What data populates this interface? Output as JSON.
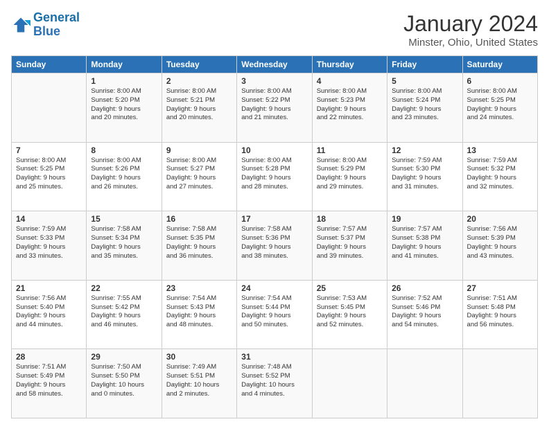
{
  "logo": {
    "line1": "General",
    "line2": "Blue"
  },
  "title": "January 2024",
  "subtitle": "Minster, Ohio, United States",
  "days_of_week": [
    "Sunday",
    "Monday",
    "Tuesday",
    "Wednesday",
    "Thursday",
    "Friday",
    "Saturday"
  ],
  "weeks": [
    [
      {
        "day": "",
        "content": ""
      },
      {
        "day": "1",
        "content": "Sunrise: 8:00 AM\nSunset: 5:20 PM\nDaylight: 9 hours\nand 20 minutes."
      },
      {
        "day": "2",
        "content": "Sunrise: 8:00 AM\nSunset: 5:21 PM\nDaylight: 9 hours\nand 20 minutes."
      },
      {
        "day": "3",
        "content": "Sunrise: 8:00 AM\nSunset: 5:22 PM\nDaylight: 9 hours\nand 21 minutes."
      },
      {
        "day": "4",
        "content": "Sunrise: 8:00 AM\nSunset: 5:23 PM\nDaylight: 9 hours\nand 22 minutes."
      },
      {
        "day": "5",
        "content": "Sunrise: 8:00 AM\nSunset: 5:24 PM\nDaylight: 9 hours\nand 23 minutes."
      },
      {
        "day": "6",
        "content": "Sunrise: 8:00 AM\nSunset: 5:25 PM\nDaylight: 9 hours\nand 24 minutes."
      }
    ],
    [
      {
        "day": "7",
        "content": "Sunrise: 8:00 AM\nSunset: 5:25 PM\nDaylight: 9 hours\nand 25 minutes."
      },
      {
        "day": "8",
        "content": "Sunrise: 8:00 AM\nSunset: 5:26 PM\nDaylight: 9 hours\nand 26 minutes."
      },
      {
        "day": "9",
        "content": "Sunrise: 8:00 AM\nSunset: 5:27 PM\nDaylight: 9 hours\nand 27 minutes."
      },
      {
        "day": "10",
        "content": "Sunrise: 8:00 AM\nSunset: 5:28 PM\nDaylight: 9 hours\nand 28 minutes."
      },
      {
        "day": "11",
        "content": "Sunrise: 8:00 AM\nSunset: 5:29 PM\nDaylight: 9 hours\nand 29 minutes."
      },
      {
        "day": "12",
        "content": "Sunrise: 7:59 AM\nSunset: 5:30 PM\nDaylight: 9 hours\nand 31 minutes."
      },
      {
        "day": "13",
        "content": "Sunrise: 7:59 AM\nSunset: 5:32 PM\nDaylight: 9 hours\nand 32 minutes."
      }
    ],
    [
      {
        "day": "14",
        "content": "Sunrise: 7:59 AM\nSunset: 5:33 PM\nDaylight: 9 hours\nand 33 minutes."
      },
      {
        "day": "15",
        "content": "Sunrise: 7:58 AM\nSunset: 5:34 PM\nDaylight: 9 hours\nand 35 minutes."
      },
      {
        "day": "16",
        "content": "Sunrise: 7:58 AM\nSunset: 5:35 PM\nDaylight: 9 hours\nand 36 minutes."
      },
      {
        "day": "17",
        "content": "Sunrise: 7:58 AM\nSunset: 5:36 PM\nDaylight: 9 hours\nand 38 minutes."
      },
      {
        "day": "18",
        "content": "Sunrise: 7:57 AM\nSunset: 5:37 PM\nDaylight: 9 hours\nand 39 minutes."
      },
      {
        "day": "19",
        "content": "Sunrise: 7:57 AM\nSunset: 5:38 PM\nDaylight: 9 hours\nand 41 minutes."
      },
      {
        "day": "20",
        "content": "Sunrise: 7:56 AM\nSunset: 5:39 PM\nDaylight: 9 hours\nand 43 minutes."
      }
    ],
    [
      {
        "day": "21",
        "content": "Sunrise: 7:56 AM\nSunset: 5:40 PM\nDaylight: 9 hours\nand 44 minutes."
      },
      {
        "day": "22",
        "content": "Sunrise: 7:55 AM\nSunset: 5:42 PM\nDaylight: 9 hours\nand 46 minutes."
      },
      {
        "day": "23",
        "content": "Sunrise: 7:54 AM\nSunset: 5:43 PM\nDaylight: 9 hours\nand 48 minutes."
      },
      {
        "day": "24",
        "content": "Sunrise: 7:54 AM\nSunset: 5:44 PM\nDaylight: 9 hours\nand 50 minutes."
      },
      {
        "day": "25",
        "content": "Sunrise: 7:53 AM\nSunset: 5:45 PM\nDaylight: 9 hours\nand 52 minutes."
      },
      {
        "day": "26",
        "content": "Sunrise: 7:52 AM\nSunset: 5:46 PM\nDaylight: 9 hours\nand 54 minutes."
      },
      {
        "day": "27",
        "content": "Sunrise: 7:51 AM\nSunset: 5:48 PM\nDaylight: 9 hours\nand 56 minutes."
      }
    ],
    [
      {
        "day": "28",
        "content": "Sunrise: 7:51 AM\nSunset: 5:49 PM\nDaylight: 9 hours\nand 58 minutes."
      },
      {
        "day": "29",
        "content": "Sunrise: 7:50 AM\nSunset: 5:50 PM\nDaylight: 10 hours\nand 0 minutes."
      },
      {
        "day": "30",
        "content": "Sunrise: 7:49 AM\nSunset: 5:51 PM\nDaylight: 10 hours\nand 2 minutes."
      },
      {
        "day": "31",
        "content": "Sunrise: 7:48 AM\nSunset: 5:52 PM\nDaylight: 10 hours\nand 4 minutes."
      },
      {
        "day": "",
        "content": ""
      },
      {
        "day": "",
        "content": ""
      },
      {
        "day": "",
        "content": ""
      }
    ]
  ]
}
